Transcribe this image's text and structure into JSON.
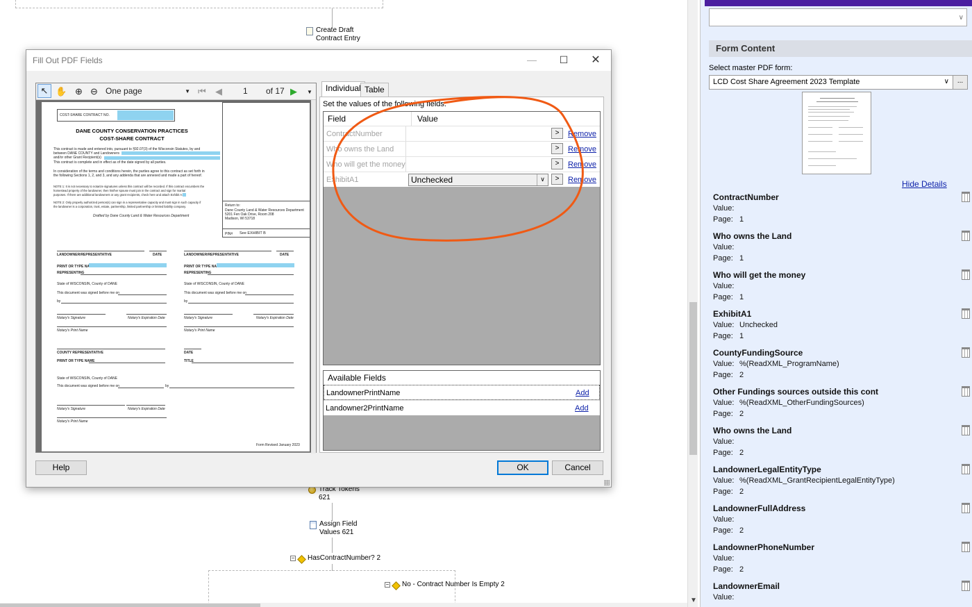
{
  "workflow": {
    "nodes": [
      {
        "id": "create-draft",
        "label1": "Create Draft",
        "label2": "Contract Entry"
      },
      {
        "id": "track-tokens",
        "label1": "Track Tokens",
        "label2": "621"
      },
      {
        "id": "assign-field",
        "label1": "Assign Field",
        "label2": "Values 621"
      },
      {
        "id": "has-contract",
        "label1": "HasContractNumber? 2",
        "label2": ""
      },
      {
        "id": "no-contract",
        "label1": "No - Contract Number Is Empty 2",
        "label2": ""
      }
    ]
  },
  "panel": {
    "section_title": "Form Content",
    "master_label": "Select master PDF form:",
    "master_value": "LCD Cost Share Agreement 2023 Template",
    "browse_label": "...",
    "hide_details": "Hide Details",
    "value_label": "Value:",
    "page_label": "Page:",
    "fields": [
      {
        "name": "ContractNumber",
        "value": "",
        "page": "1"
      },
      {
        "name": "Who owns the Land",
        "value": "",
        "page": "1"
      },
      {
        "name": "Who will get the money",
        "value": "",
        "page": "1"
      },
      {
        "name": "ExhibitA1",
        "value": "Unchecked",
        "page": "1"
      },
      {
        "name": "CountyFundingSource",
        "value": "%(ReadXML_ProgramName)",
        "page": "2"
      },
      {
        "name": "Other Fundings sources outside this cont",
        "value": "%(ReadXML_OtherFundingSources)",
        "page": "2"
      },
      {
        "name": "Who owns the Land",
        "value": "",
        "page": "2"
      },
      {
        "name": "LandownerLegalEntityType",
        "value": "%(ReadXML_GrantRecipientLegalEntityType)",
        "page": "2"
      },
      {
        "name": "LandownerFullAddress",
        "value": "",
        "page": "2"
      },
      {
        "name": "LandownerPhoneNumber",
        "value": "",
        "page": "2"
      },
      {
        "name": "LandownerEmail",
        "value": "",
        "page": ""
      }
    ]
  },
  "dialog": {
    "title": "Fill Out PDF Fields",
    "viewer": {
      "zoom_mode": "One page",
      "current_page": "1",
      "page_count": "of 17"
    },
    "pdf": {
      "contract_no_label": "COST-SHARE CONTRACT NO.",
      "heading1": "DANE COUNTY CONSERVATION PRACTICES",
      "heading2": "COST-SHARE CONTRACT",
      "para1a": "This contract is made and entered into, pursuant to §92.07(3) of the Wisconsin Statutes, by and",
      "para1b": "between DANE COUNTY and Landowners",
      "para1c": "and/or other Grant Recipient(s)",
      "para1d": "This contract is complete and in effect as of the date signed by all parties.",
      "para2a": "In consideration of the terms and conditions herein, the parties agree to this contract as set forth in",
      "para2b": "the following Sections 1, 2, and 3, and any addenda that are annexed and made a part of hereof.",
      "note1a": "NOTE 1: It is not necessary to notarize signatures unless this contract will be recorded. If this contract encumbers the",
      "note1b": "homestead property of the landowner, then his/her spouse must join in the contract and sign for marital",
      "note1c": "purposes.  If there are additional landowners or any grant recipients, check here and attach Exhibit A1.",
      "note2a": "NOTE 2:  Only properly authorized person(s) can sign in a representative capacity and must sign in such capacity if",
      "note2b": "the landowner is a corporation, trust, estate, partnership, limited partnership or limited liability company.",
      "drafted": "Drafted by Dane County Land & Water Resources Department",
      "return_to": "Return to:",
      "return_addr1": "Dane County Land & Water Resources Department",
      "return_addr2": "5201 Fen Oak Drive, Room 208",
      "return_addr3": "Madison, WI 53718",
      "pin_label": "PIN#",
      "pin_value": "See EXHIBIT B",
      "lo_rep": "LANDOWNER/REPRESENTATIVE",
      "date": "DATE",
      "print_name": "PRINT OR TYPE NAME",
      "representing": "REPRESENTING",
      "state": "State of WISCONSIN, County of DANE",
      "signed_before": "This document was signed before me on",
      "by": "by",
      "notary_sig": "Notary's Signature",
      "notary_exp": "Notary's Expiration Date",
      "notary_print": "Notary's Print Name",
      "county_rep": "COUNTY REPRESENTATIVE",
      "title": "TITLE",
      "form_revised": "Form Revised January 2023"
    },
    "tabs": [
      "Individual",
      "Table"
    ],
    "instructions": "Set the values of the following fields:",
    "grid": {
      "headers": [
        "Field",
        "Value"
      ],
      "rows": [
        {
          "field": "ContractNumber",
          "value": "",
          "action": "Remove"
        },
        {
          "field": "Who owns the Land",
          "value": "",
          "action": "Remove"
        },
        {
          "field": "Who will get the money",
          "value": "",
          "action": "Remove"
        },
        {
          "field": "ExhibitA1",
          "value": "Unchecked",
          "action": "Remove"
        }
      ]
    },
    "available": {
      "header": "Available Fields",
      "rows": [
        {
          "name": "LandownerPrintName",
          "action": "Add"
        },
        {
          "name": "Landowner2PrintName",
          "action": "Add"
        }
      ]
    },
    "buttons": {
      "help": "Help",
      "ok": "OK",
      "cancel": "Cancel"
    }
  },
  "colors": {
    "annotation": "#f05a14",
    "link": "#0b1fa8",
    "pdf_fill": "#8fd3f0",
    "panel_bg": "#e7effd",
    "title_band": "#4b1fa0"
  }
}
